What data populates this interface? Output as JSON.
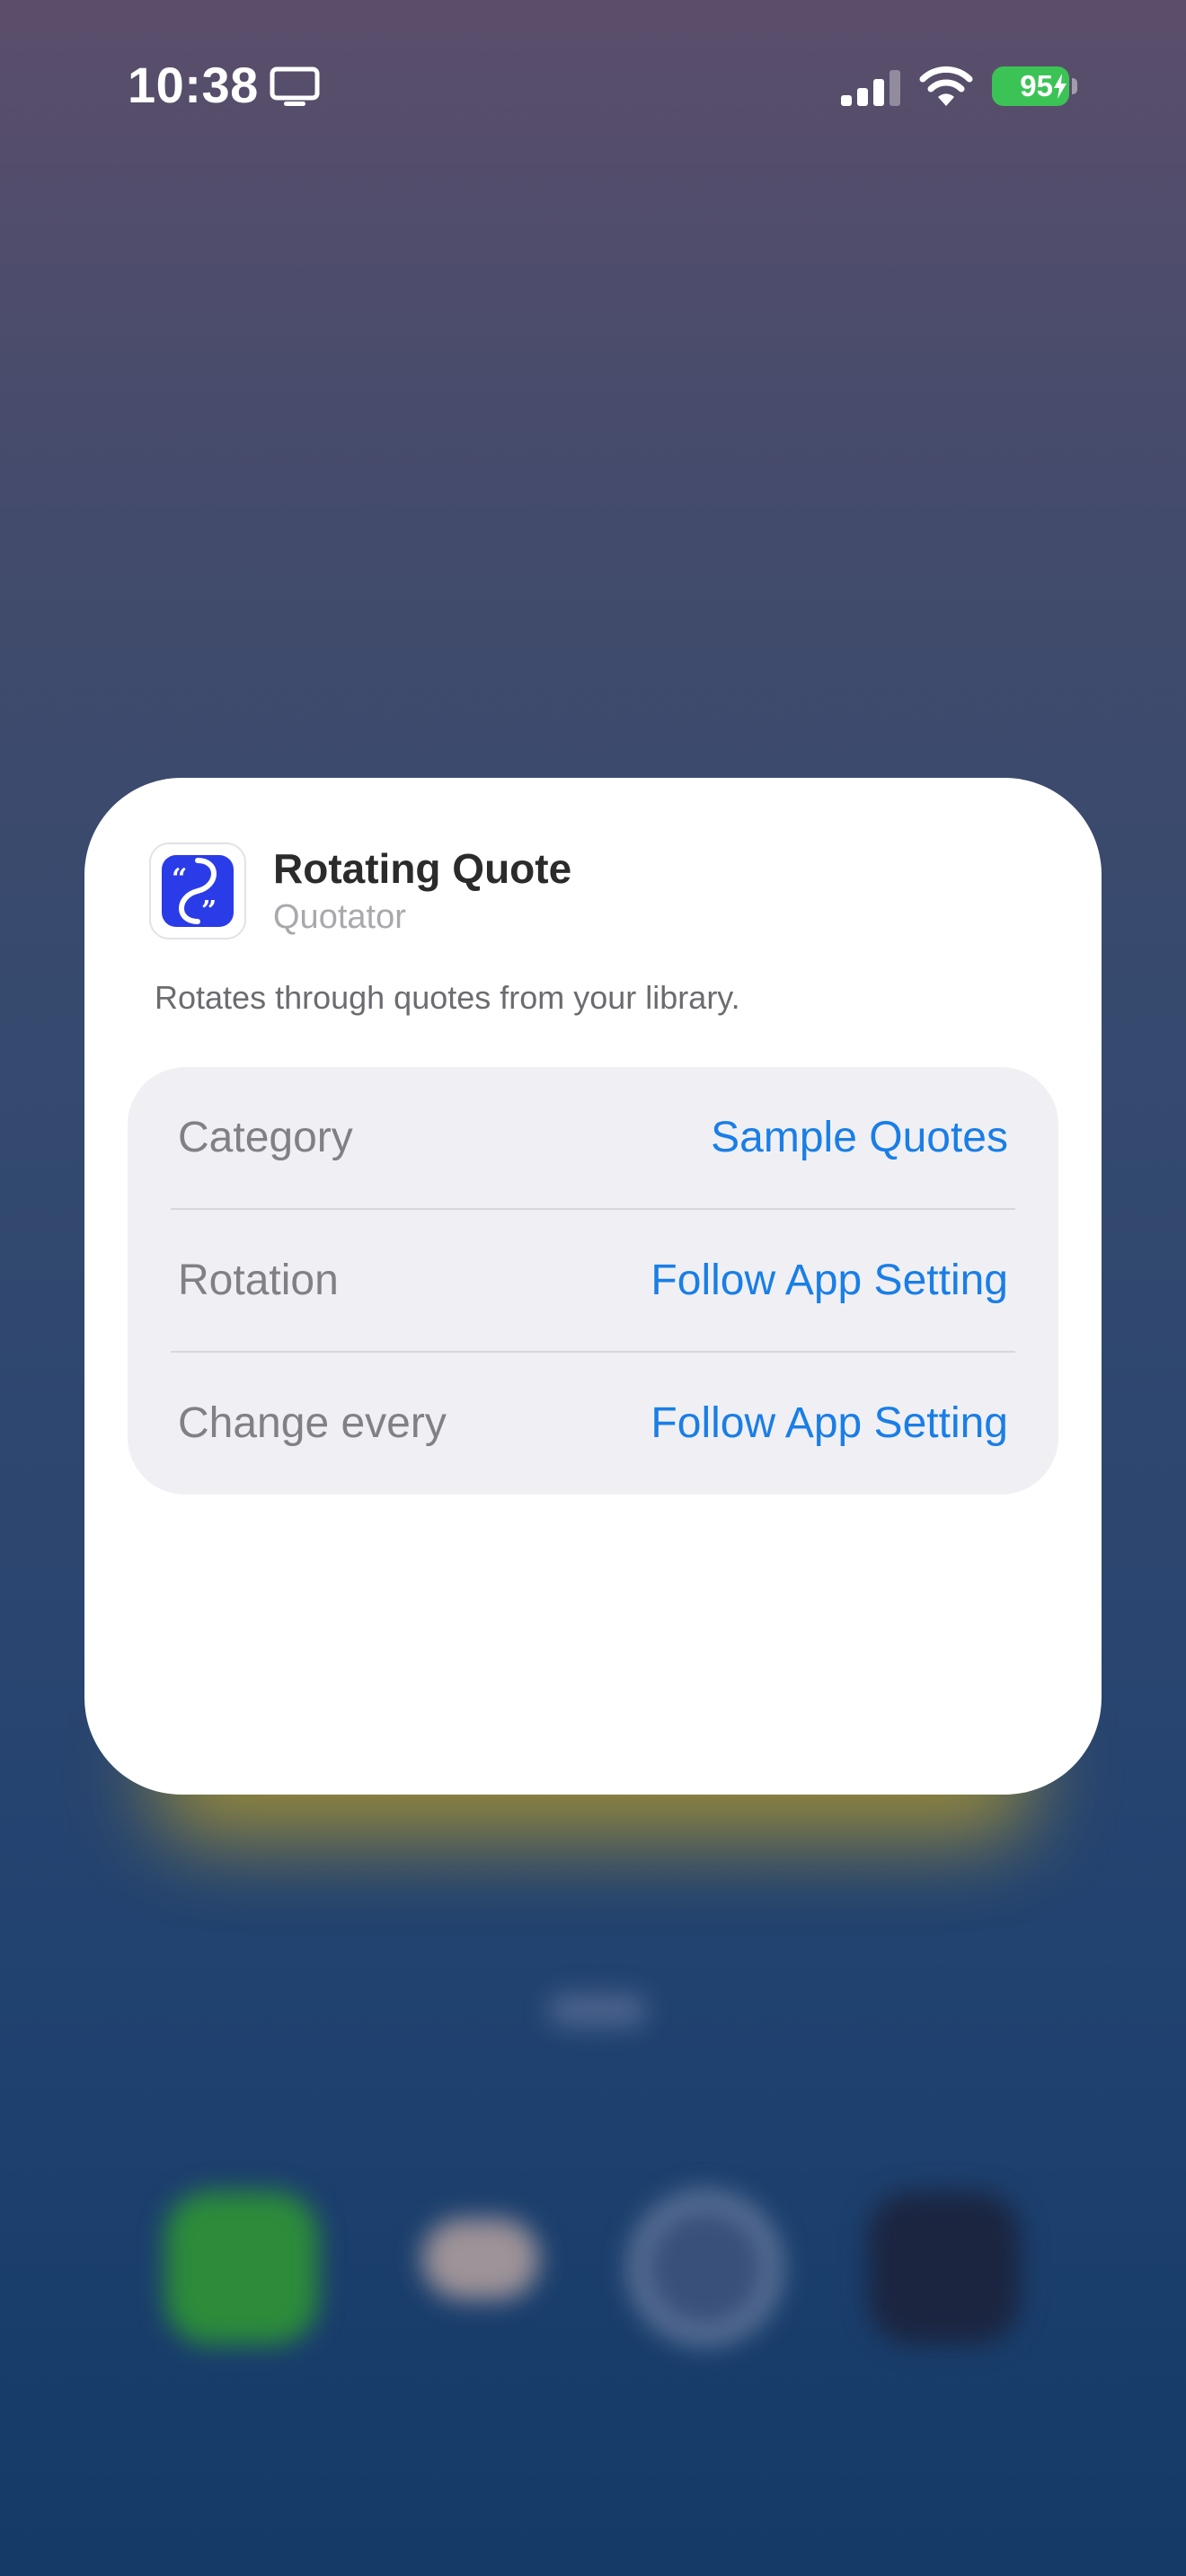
{
  "status_bar": {
    "time": "10:38",
    "battery_percent": "95",
    "battery_color": "#3cc356",
    "icons": [
      "screen-mirroring-icon",
      "cellular-signal-icon",
      "wifi-icon",
      "battery-charging-icon"
    ]
  },
  "widget": {
    "title": "Rotating Quote",
    "app_name": "Quotator",
    "description": "Rotates through quotes from your library.",
    "icon": "quote-app-icon",
    "settings": [
      {
        "label": "Category",
        "value": "Sample Quotes"
      },
      {
        "label": "Rotation",
        "value": "Follow App Setting"
      },
      {
        "label": "Change every",
        "value": "Follow App Setting"
      }
    ]
  },
  "colors": {
    "accent": "#1a7ee6",
    "app_icon_blue": "#2a3ce8"
  }
}
